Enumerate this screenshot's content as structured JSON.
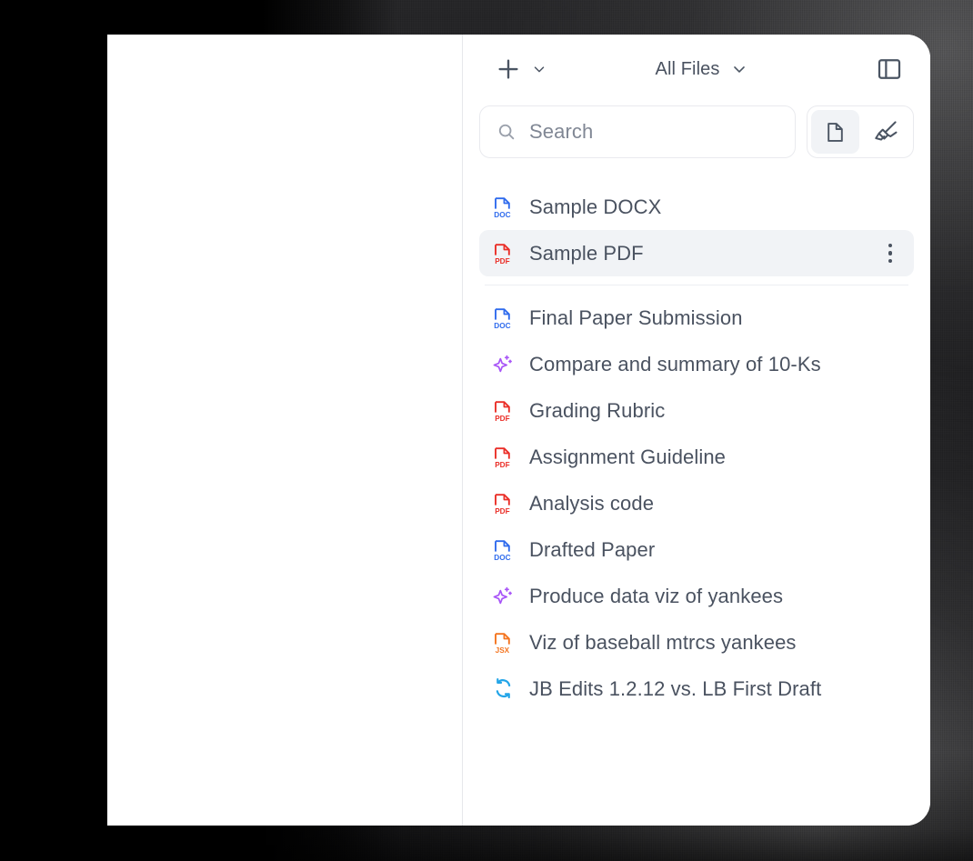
{
  "window": {
    "title": "File Browser Sidebar"
  },
  "toolbar": {
    "new_label": "+",
    "new_icon": "plus-icon",
    "new_dropdown_icon": "chevron-down-icon",
    "filter_label": "All Files",
    "filter_dropdown_icon": "chevron-down-icon",
    "panel_toggle_icon": "sidebar-panel-icon"
  },
  "search": {
    "placeholder": "Search",
    "value": "",
    "icon": "search-icon"
  },
  "view_toggle": {
    "options": [
      {
        "id": "documents",
        "icon": "document-page-icon",
        "active": true
      },
      {
        "id": "highlights",
        "icon": "highlighter-icon",
        "active": false
      }
    ]
  },
  "pinned_files": [
    {
      "name": "Sample DOCX",
      "type": "DOC",
      "icon": "doc-file-icon",
      "color": "#2f6bed",
      "selected": false,
      "has_menu": false
    },
    {
      "name": "Sample PDF",
      "type": "PDF",
      "icon": "pdf-file-icon",
      "color": "#ea2f28",
      "selected": true,
      "has_menu": true
    }
  ],
  "files": [
    {
      "name": "Final Paper Submission",
      "type": "DOC",
      "icon": "doc-file-icon",
      "color": "#2f6bed"
    },
    {
      "name": "Compare and summary of 10-Ks",
      "type": "AI",
      "icon": "sparkle-icon",
      "color": "#a855f7"
    },
    {
      "name": "Grading Rubric",
      "type": "PDF",
      "icon": "pdf-file-icon",
      "color": "#ea2f28"
    },
    {
      "name": "Assignment Guideline",
      "type": "PDF",
      "icon": "pdf-file-icon",
      "color": "#ea2f28"
    },
    {
      "name": "Analysis code",
      "type": "PDF",
      "icon": "pdf-file-icon",
      "color": "#ea2f28"
    },
    {
      "name": "Drafted Paper",
      "type": "DOC",
      "icon": "doc-file-icon",
      "color": "#2f6bed"
    },
    {
      "name": "Produce data viz of yankees",
      "type": "AI",
      "icon": "sparkle-icon",
      "color": "#a855f7"
    },
    {
      "name": "Viz of baseball mtrcs yankees",
      "type": "JSX",
      "icon": "jsx-file-icon",
      "color": "#f4741f"
    },
    {
      "name": "JB Edits 1.2.12 vs. LB First Draft",
      "type": "COMPARE",
      "icon": "compare-sync-icon",
      "color": "#23a5e8"
    }
  ],
  "colors": {
    "text": "#4a5260",
    "placeholder": "#808794",
    "selected_row_bg": "#f1f3f6",
    "border": "#e9eaee",
    "separator": "#eceef2",
    "doc_blue": "#2f6bed",
    "pdf_red": "#ea2f28",
    "sparkle_purple": "#a855f7",
    "jsx_orange": "#f4741f",
    "compare_cyan": "#23a5e8",
    "backdrop_dark": "#1a1a1c"
  }
}
